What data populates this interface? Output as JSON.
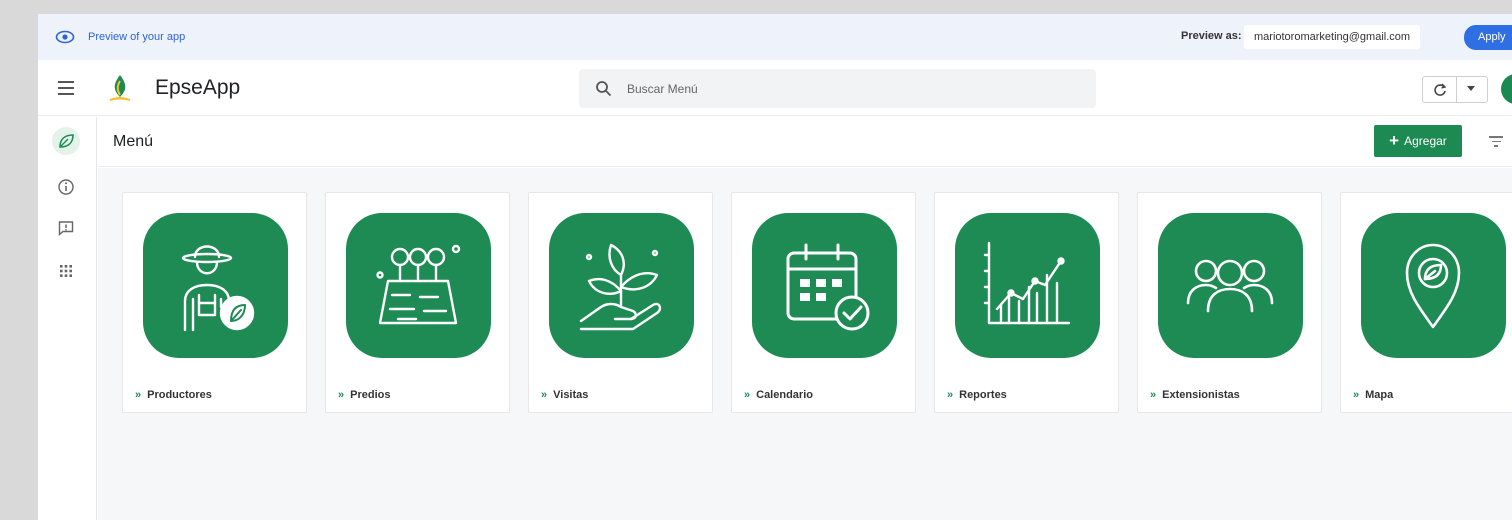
{
  "preview": {
    "label": "Preview of your app",
    "preview_as_label": "Preview as:",
    "email": "mariotoromarketing@gmail.com",
    "apply_label": "Apply"
  },
  "header": {
    "app_name": "EpseApp",
    "search_placeholder": "Buscar Menú"
  },
  "toolbar": {
    "title": "Menú",
    "add_label": "Agregar"
  },
  "colors": {
    "brand_green": "#1e8b54",
    "link_blue": "#2e63d8",
    "apply_blue": "#2f6fe4"
  },
  "cards": [
    {
      "label": "Productores",
      "icon": "farmer-icon"
    },
    {
      "label": "Predios",
      "icon": "land-plot-icon"
    },
    {
      "label": "Visitas",
      "icon": "plant-hand-icon"
    },
    {
      "label": "Calendario",
      "icon": "calendar-check-icon"
    },
    {
      "label": "Reportes",
      "icon": "chart-icon"
    },
    {
      "label": "Extensionistas",
      "icon": "people-icon"
    },
    {
      "label": "Mapa",
      "icon": "map-pin-icon"
    }
  ]
}
